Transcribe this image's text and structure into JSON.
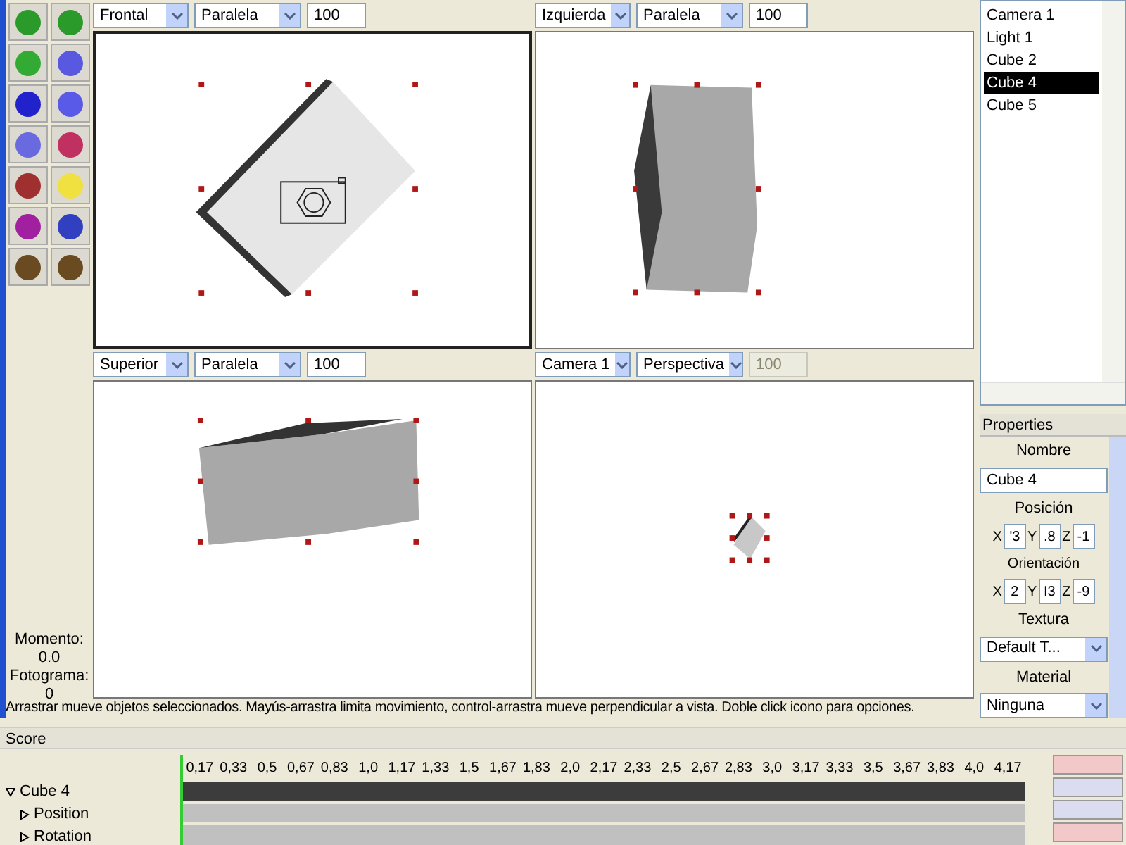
{
  "viewports": [
    {
      "view": "Frontal",
      "projection": "Paralela",
      "zoom": "100",
      "zoom_disabled": false,
      "active": true
    },
    {
      "view": "Izquierda",
      "projection": "Paralela",
      "zoom": "100",
      "zoom_disabled": false,
      "active": false
    },
    {
      "view": "Superior",
      "projection": "Paralela",
      "zoom": "100",
      "zoom_disabled": false,
      "active": false
    },
    {
      "view": "Camera 1",
      "projection": "Perspectiva",
      "zoom": "100",
      "zoom_disabled": true,
      "active": false
    }
  ],
  "info": {
    "time_label": "Momento:",
    "time_value": "0.0",
    "frame_label": "Fotograma:",
    "frame_value": "0"
  },
  "status_bar": "Arrastrar mueve objetos seleccionados. Mayús-arrastra limita movimiento, control-arrastra mueve perpendicular a vista. Doble click icono para opciones.",
  "objects": [
    {
      "label": "Camera 1",
      "selected": false
    },
    {
      "label": "Light 1",
      "selected": false
    },
    {
      "label": "Cube 2",
      "selected": false
    },
    {
      "label": "Cube 4",
      "selected": true
    },
    {
      "label": "Cube 5",
      "selected": false
    }
  ],
  "properties": {
    "title": "Properties",
    "name_label": "Nombre",
    "name_value": "Cube 4",
    "position_label": "Posición",
    "position": [
      {
        "axis": "X",
        "value": "'3"
      },
      {
        "axis": "Y",
        "value": ".8"
      },
      {
        "axis": "Z",
        "value": "-1"
      }
    ],
    "orientation_label": "Orientación",
    "orientation": [
      {
        "axis": "X",
        "value": "2"
      },
      {
        "axis": "Y",
        "value": "I3"
      },
      {
        "axis": "Z",
        "value": "-9"
      }
    ],
    "texture_label": "Textura",
    "texture_value": "Default T...",
    "material_label": "Material",
    "material_value": "Ninguna"
  },
  "score": {
    "title": "Score",
    "ticks": [
      "0,17",
      "0,33",
      "0,5",
      "0,67",
      "0,83",
      "1,0",
      "1,17",
      "1,33",
      "1,5",
      "1,67",
      "1,83",
      "2,0",
      "2,17",
      "2,33",
      "2,5",
      "2,67",
      "2,83",
      "3,0",
      "3,17",
      "3,33",
      "3,5",
      "3,67",
      "3,83",
      "4,0",
      "4,17"
    ],
    "tracks": [
      {
        "label": "Cube 4",
        "expanded": true,
        "children": [
          {
            "label": "Position",
            "expanded": false
          },
          {
            "label": "Rotation",
            "expanded": false
          }
        ]
      }
    ]
  }
}
